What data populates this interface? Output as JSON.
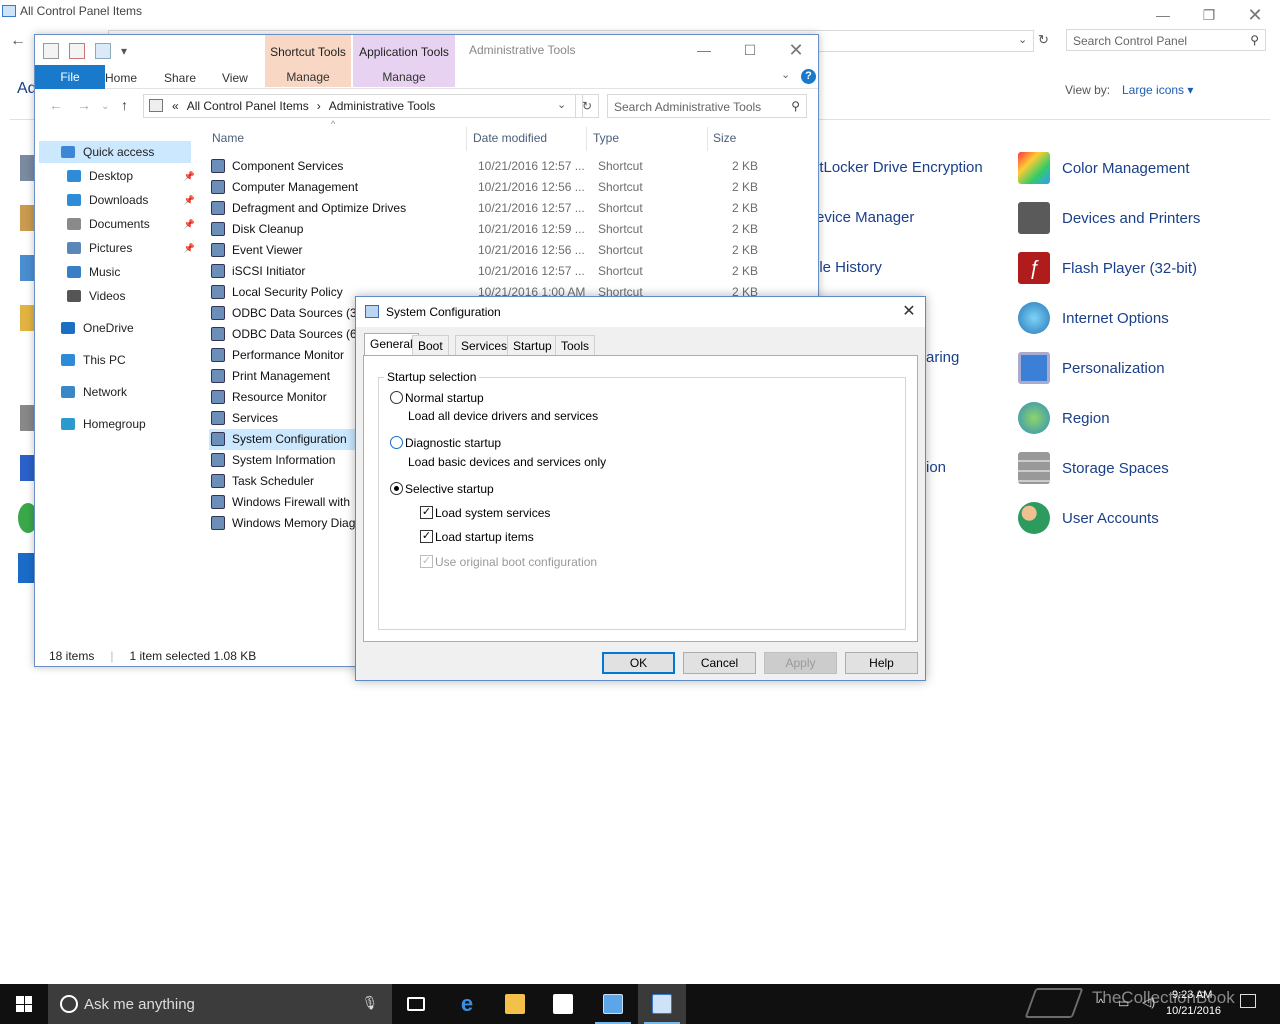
{
  "control_panel": {
    "title": "All Control Panel Items",
    "search_placeholder": "Search Control Panel",
    "heading_fragment": "Ad",
    "view_by_label": "View by:",
    "view_by_value": "Large icons ▾",
    "items_mid": [
      {
        "label": "itLocker Drive Encryption",
        "color": "#6a6a6a"
      },
      {
        "label": "evice Manager",
        "color": "#6a6a6a"
      },
      {
        "label": "ile History",
        "color": "#d9a93a"
      },
      {
        "label": "aring",
        "color": "#1a3f8a"
      },
      {
        "label": "ion",
        "color": "#1a3f8a"
      }
    ],
    "items_right": [
      {
        "label": "Color Management",
        "icon": "color-management-icon",
        "color": "#4a9bd6"
      },
      {
        "label": "Devices and Printers",
        "icon": "printer-icon",
        "color": "#555555"
      },
      {
        "label": "Flash Player (32-bit)",
        "icon": "flash-icon",
        "color": "#b01b1b"
      },
      {
        "label": "Internet Options",
        "icon": "globe-icon",
        "color": "#3b86c6"
      },
      {
        "label": "Personalization",
        "icon": "monitor-icon",
        "color": "#3b7fd6"
      },
      {
        "label": "Region",
        "icon": "region-globe-icon",
        "color": "#2f8fbd"
      },
      {
        "label": "Storage Spaces",
        "icon": "storage-icon",
        "color": "#7b7b7b"
      },
      {
        "label": "User Accounts",
        "icon": "users-icon",
        "color": "#2d9a5e"
      }
    ]
  },
  "explorer": {
    "window_title": "Administrative Tools",
    "contextual_tabs": [
      {
        "label": "Shortcut Tools",
        "sub": "Manage"
      },
      {
        "label": "Application Tools",
        "sub": "Manage"
      }
    ],
    "ribbon_tabs": [
      "File",
      "Home",
      "Share",
      "View"
    ],
    "help": "?",
    "breadcrumb": [
      "«",
      "All Control Panel Items",
      "›",
      "Administrative Tools"
    ],
    "search_placeholder": "Search Administrative Tools",
    "nav_pane": [
      {
        "label": "Quick access",
        "icon": "star-icon",
        "color": "#3b86d6",
        "pinned": false,
        "indent": 0
      },
      {
        "label": "Desktop",
        "icon": "desktop-folder-icon",
        "color": "#2d8bd8",
        "pinned": true,
        "indent": 1
      },
      {
        "label": "Downloads",
        "icon": "download-icon",
        "color": "#2d8bd8",
        "pinned": true,
        "indent": 1
      },
      {
        "label": "Documents",
        "icon": "documents-icon",
        "color": "#8a8a8a",
        "pinned": true,
        "indent": 1
      },
      {
        "label": "Pictures",
        "icon": "pictures-icon",
        "color": "#5a87b8",
        "pinned": true,
        "indent": 1
      },
      {
        "label": "Music",
        "icon": "music-icon",
        "color": "#3a7fc5",
        "pinned": false,
        "indent": 1
      },
      {
        "label": "Videos",
        "icon": "videos-icon",
        "color": "#555555",
        "pinned": false,
        "indent": 1
      },
      {
        "label": "OneDrive",
        "icon": "onedrive-icon",
        "color": "#1b6fc2",
        "pinned": false,
        "indent": 0
      },
      {
        "label": "This PC",
        "icon": "pc-icon",
        "color": "#2d8bd8",
        "pinned": false,
        "indent": 0
      },
      {
        "label": "Network",
        "icon": "network-icon",
        "color": "#3b86c6",
        "pinned": false,
        "indent": 0
      },
      {
        "label": "Homegroup",
        "icon": "homegroup-icon",
        "color": "#2c9ad1",
        "pinned": false,
        "indent": 0
      }
    ],
    "columns": [
      "Name",
      "Date modified",
      "Type",
      "Size"
    ],
    "files": [
      {
        "name": "Component Services",
        "date": "10/21/2016 12:57 ...",
        "type": "Shortcut",
        "size": "2 KB"
      },
      {
        "name": "Computer Management",
        "date": "10/21/2016 12:56 ...",
        "type": "Shortcut",
        "size": "2 KB"
      },
      {
        "name": "Defragment and Optimize Drives",
        "date": "10/21/2016 12:57 ...",
        "type": "Shortcut",
        "size": "2 KB"
      },
      {
        "name": "Disk Cleanup",
        "date": "10/21/2016 12:59 ...",
        "type": "Shortcut",
        "size": "2 KB"
      },
      {
        "name": "Event Viewer",
        "date": "10/21/2016 12:56 ...",
        "type": "Shortcut",
        "size": "2 KB"
      },
      {
        "name": "iSCSI Initiator",
        "date": "10/21/2016 12:57 ...",
        "type": "Shortcut",
        "size": "2 KB"
      },
      {
        "name": "Local Security Policy",
        "date": "10/21/2016 1:00 AM",
        "type": "Shortcut",
        "size": "2 KB"
      },
      {
        "name": "ODBC Data Sources (32",
        "date": "",
        "type": "",
        "size": ""
      },
      {
        "name": "ODBC Data Sources (64",
        "date": "",
        "type": "",
        "size": ""
      },
      {
        "name": "Performance Monitor",
        "date": "",
        "type": "",
        "size": ""
      },
      {
        "name": "Print Management",
        "date": "",
        "type": "",
        "size": ""
      },
      {
        "name": "Resource Monitor",
        "date": "",
        "type": "",
        "size": ""
      },
      {
        "name": "Services",
        "date": "",
        "type": "",
        "size": ""
      },
      {
        "name": "System Configuration",
        "date": "",
        "type": "",
        "size": ""
      },
      {
        "name": "System Information",
        "date": "",
        "type": "",
        "size": ""
      },
      {
        "name": "Task Scheduler",
        "date": "",
        "type": "",
        "size": ""
      },
      {
        "name": "Windows Firewall with",
        "date": "",
        "type": "",
        "size": ""
      },
      {
        "name": "Windows Memory Diag",
        "date": "",
        "type": "",
        "size": ""
      }
    ],
    "status_count": "18 items",
    "status_selected": "1 item selected  1.08 KB"
  },
  "sysconfig": {
    "title": "System Configuration",
    "tabs": [
      "General",
      "Boot",
      "Services",
      "Startup",
      "Tools"
    ],
    "group_label": "Startup selection",
    "normal_label": "Normal startup",
    "normal_desc": "Load all device drivers and services",
    "diagnostic_label": "Diagnostic startup",
    "diagnostic_desc": "Load basic devices and services only",
    "selective_label": "Selective startup",
    "opt_services": "Load system services",
    "opt_startup": "Load startup items",
    "opt_boot": "Use original boot configuration",
    "ok": "OK",
    "cancel": "Cancel",
    "apply": "Apply",
    "help": "Help"
  },
  "taskbar": {
    "search_placeholder": "Ask me anything",
    "time": "9:23 AM",
    "date": "10/21/2016",
    "watermark": "TheCollectionBook"
  }
}
